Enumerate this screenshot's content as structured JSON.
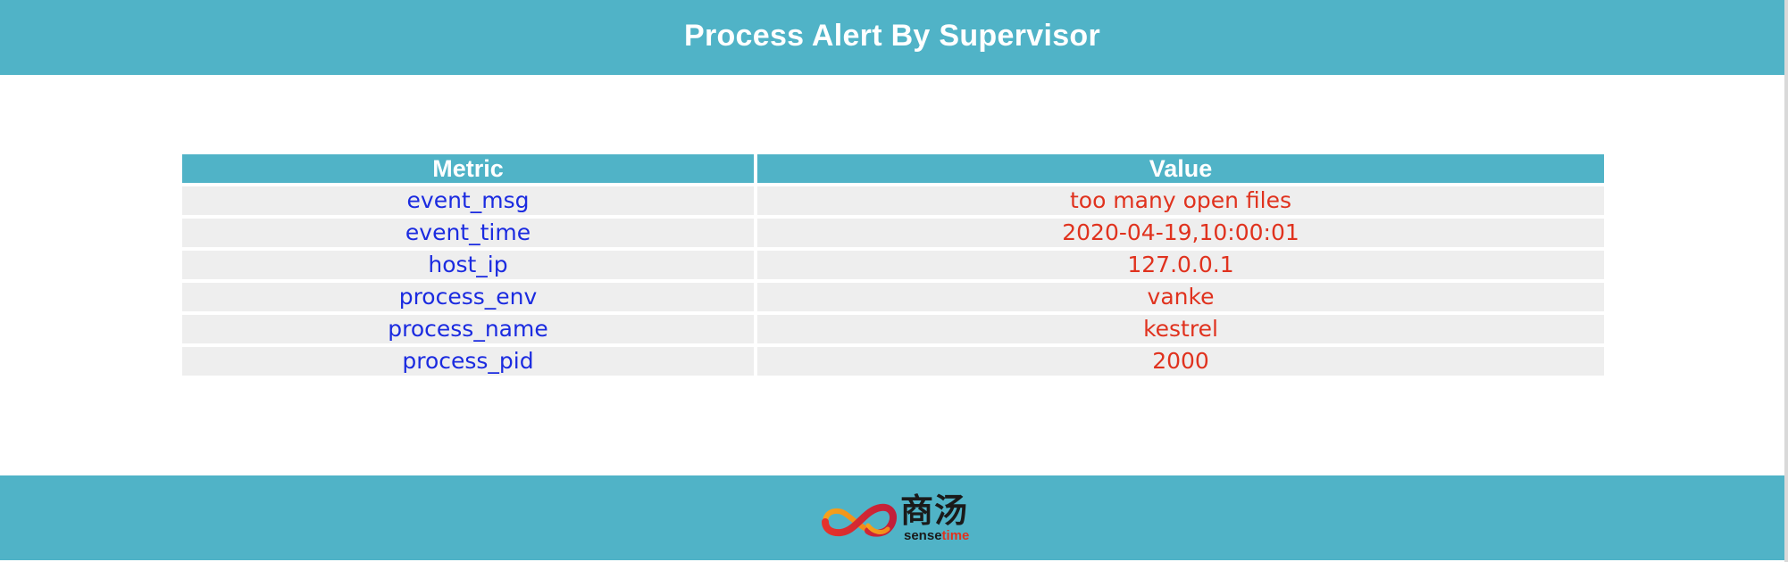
{
  "header": {
    "title": "Process Alert By Supervisor"
  },
  "table": {
    "columns": [
      "Metric",
      "Value"
    ],
    "rows": [
      {
        "metric": "event_msg",
        "value": "too many open files"
      },
      {
        "metric": "event_time",
        "value": "2020-04-19,10:00:01"
      },
      {
        "metric": "host_ip",
        "value": "127.0.0.1"
      },
      {
        "metric": "process_env",
        "value": "vanke"
      },
      {
        "metric": "process_name",
        "value": "kestrel"
      },
      {
        "metric": "process_pid",
        "value": "2000"
      }
    ]
  },
  "footer": {
    "logo": {
      "icon": "sensetime-infinity-logo-icon",
      "text_cn": "商汤",
      "text_en_part1": "sense",
      "text_en_part2": "time"
    }
  },
  "colors": {
    "accent": "#50b3c7",
    "metric_text": "#1b2be0",
    "value_text": "#e0321e",
    "row_background": "#eeeeee"
  }
}
